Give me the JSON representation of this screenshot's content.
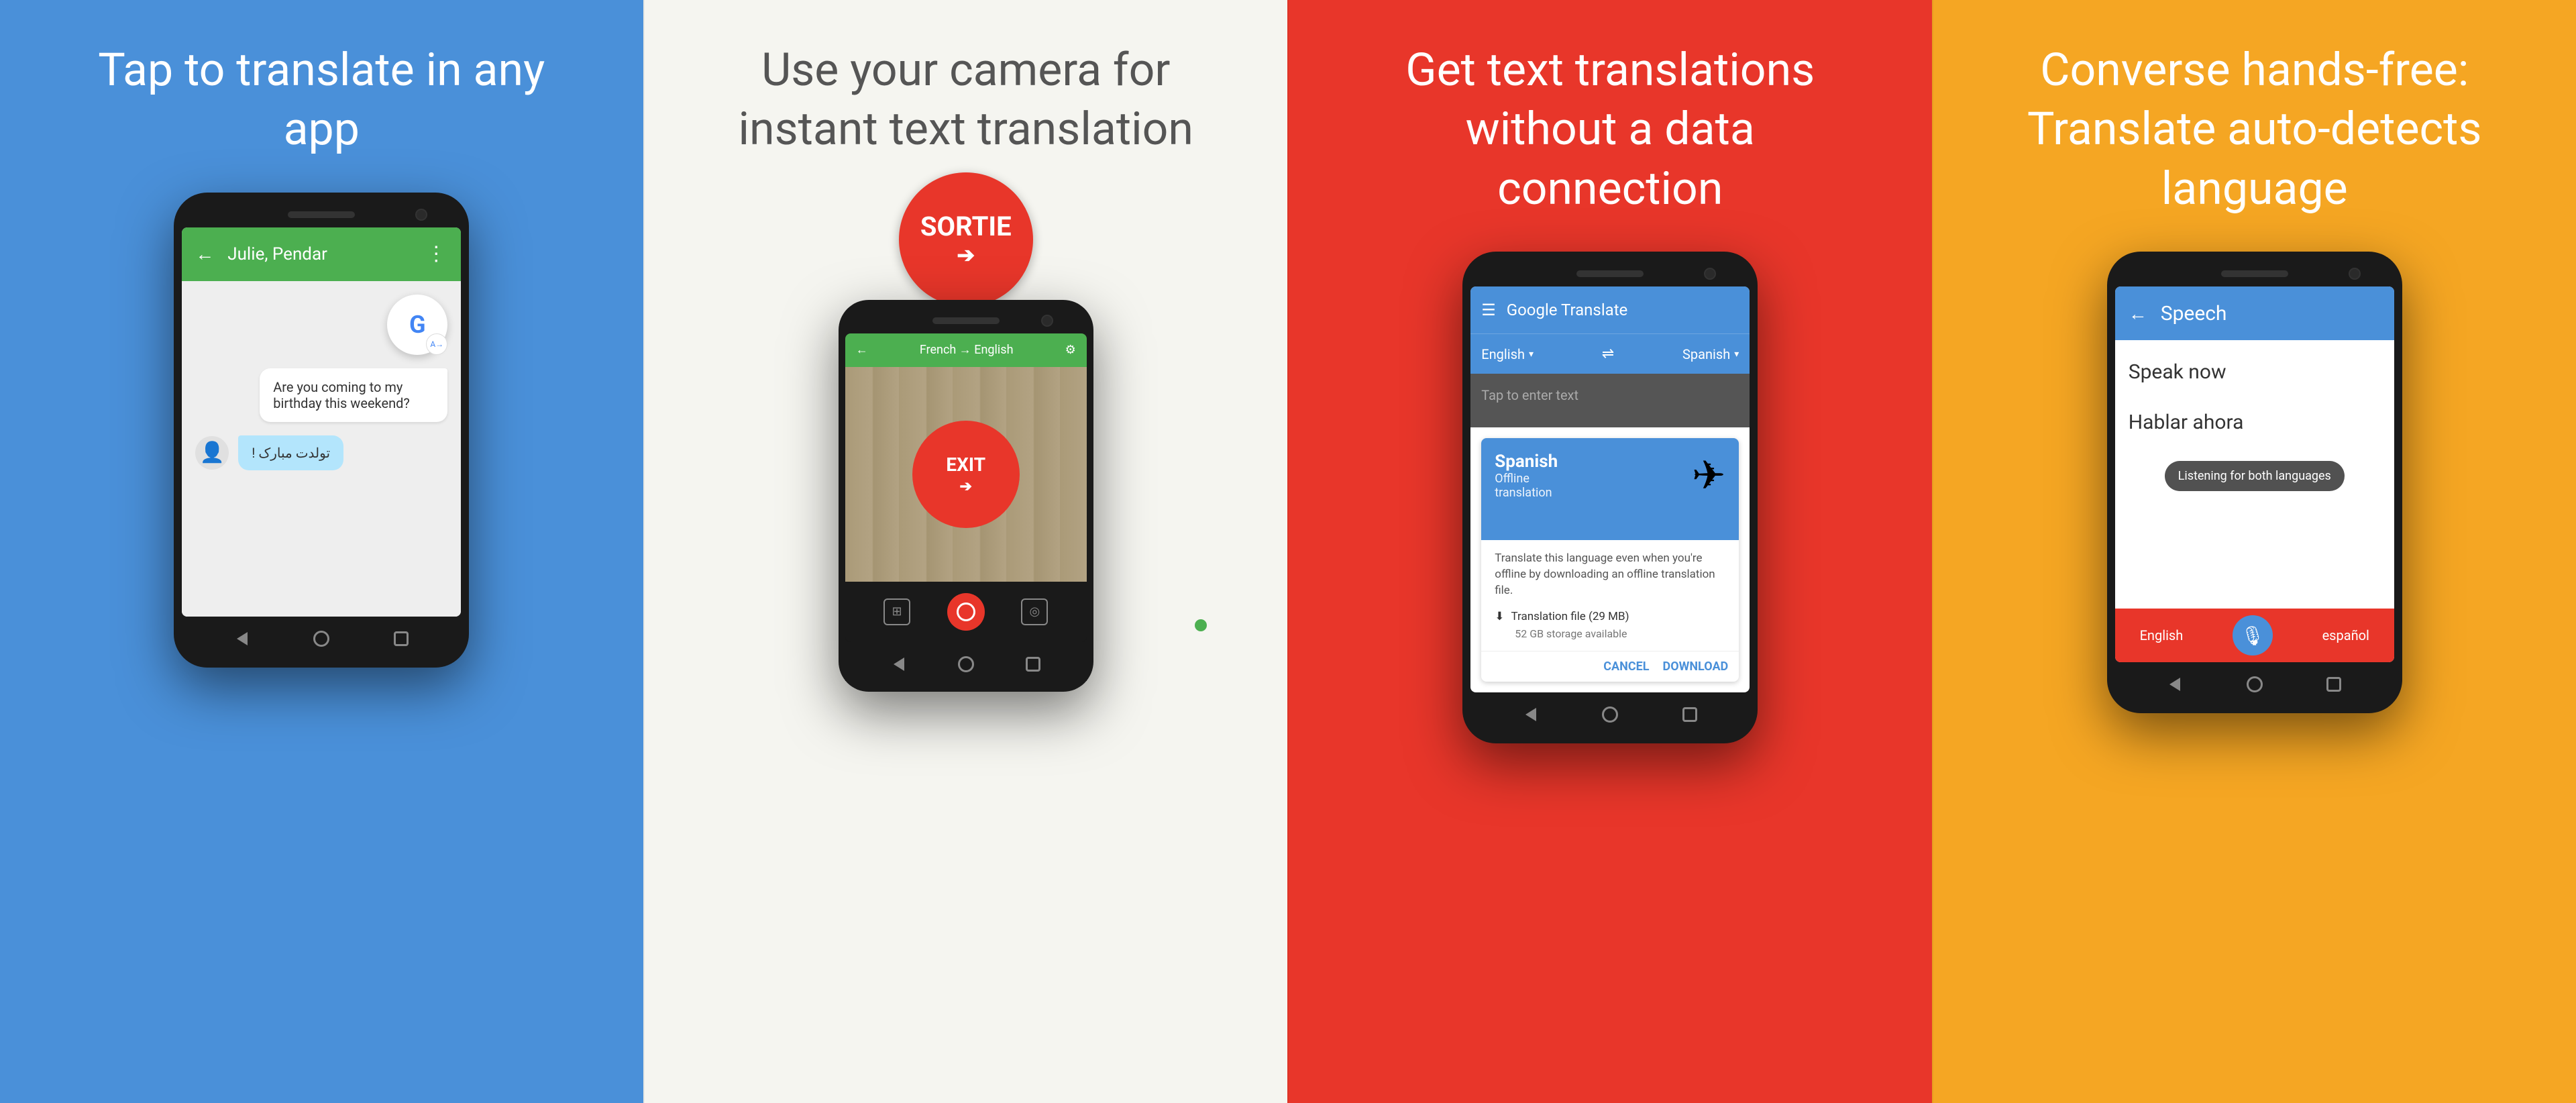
{
  "panels": [
    {
      "id": "panel-1",
      "background": "#4A90D9",
      "title": "Tap to translate in any app",
      "chat": {
        "header": {
          "back": "←",
          "title": "Julie, Pendar",
          "dots": "⋮"
        },
        "bubble_right": "Are you coming to my birthday this weekend?",
        "bubble_left": "تولدت مبارک !"
      }
    },
    {
      "id": "panel-2",
      "background": "#F5F5F0",
      "title": "Use your camera for instant text translation",
      "sortie_text": "SORTIE",
      "exit_text": "EXIT",
      "camera_header": "French → English"
    },
    {
      "id": "panel-3",
      "background": "#E8362A",
      "title": "Get text translations without a data connection",
      "translate": {
        "app_title": "Google Translate",
        "lang_from": "English",
        "lang_to": "Spanish",
        "input_placeholder": "Tap to enter text",
        "offline_card": {
          "title": "Spanish",
          "subtitle1": "Offline",
          "subtitle2": "translation",
          "description": "Translate this language even when you're offline by downloading an offline translation file.",
          "file_label": "Translation file (29 MB)",
          "storage_label": "52 GB storage available",
          "cancel_btn": "CANCEL",
          "download_btn": "DOWNLOAD"
        }
      }
    },
    {
      "id": "panel-4",
      "background": "#F5A623",
      "title": "Converse hands-free: Translate auto-detects language",
      "speech": {
        "header_title": "Speech",
        "speak_now": "Speak now",
        "hablar_ahora": "Hablar ahora",
        "listening_banner": "Listening for both languages",
        "lang_english": "English",
        "lang_espanol": "español"
      }
    }
  ]
}
